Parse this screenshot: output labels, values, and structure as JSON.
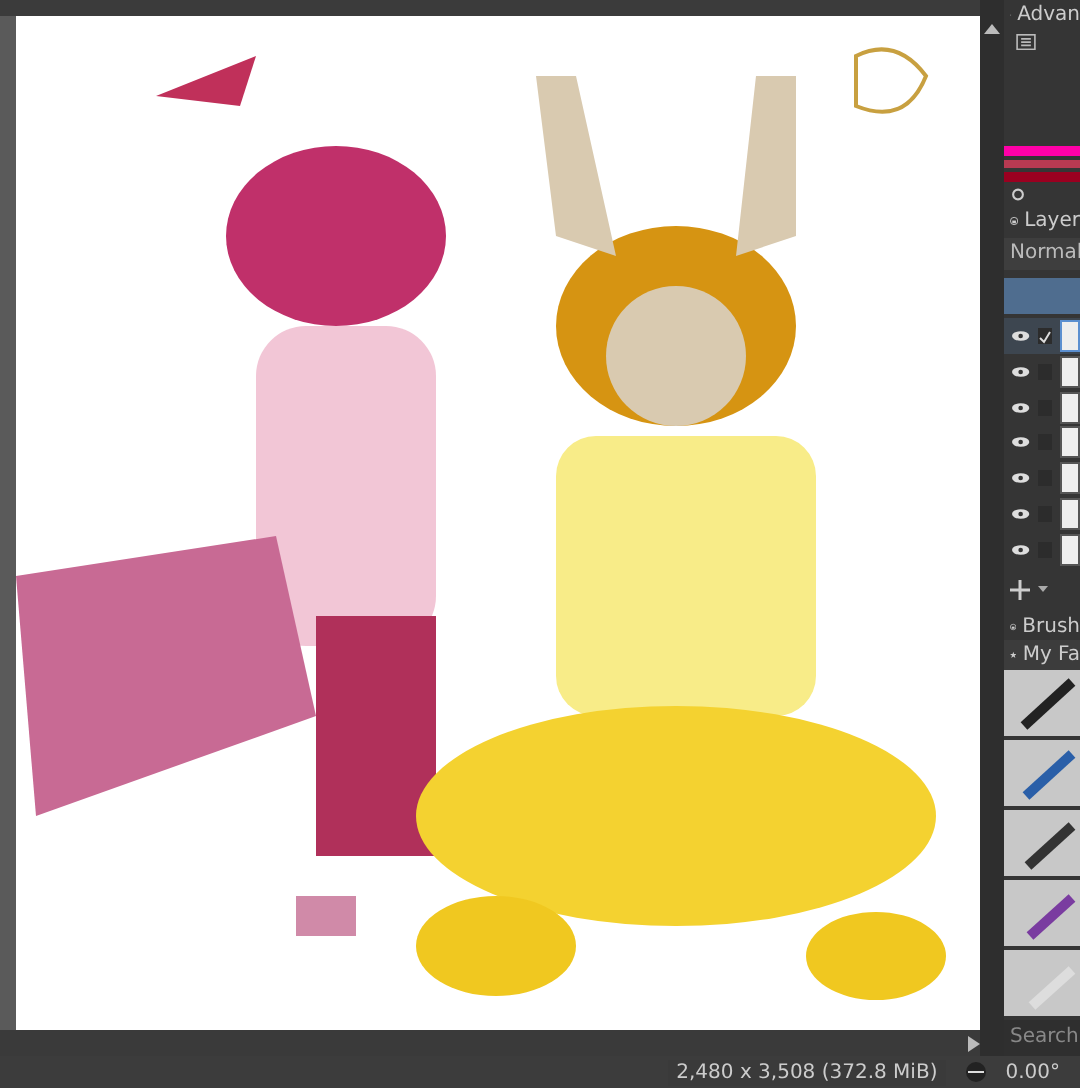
{
  "dockers": {
    "advanced_color": {
      "title": "Advan"
    },
    "layers": {
      "title": "Layer",
      "blend_mode": "Normal",
      "rows": [
        {
          "checked": true,
          "selected": true
        },
        {
          "checked": false,
          "selected": false
        },
        {
          "checked": false,
          "selected": false
        },
        {
          "checked": false,
          "selected": false
        },
        {
          "checked": false,
          "selected": false
        },
        {
          "checked": false,
          "selected": false
        },
        {
          "checked": false,
          "selected": false
        }
      ]
    },
    "brushes": {
      "title": "Brush",
      "tag": "My Fa",
      "search": {
        "placeholder": "Search"
      }
    }
  },
  "status_bar": {
    "size": "2,480 x 3,508 (372.8 MiB)",
    "rotation": "0.00°"
  }
}
